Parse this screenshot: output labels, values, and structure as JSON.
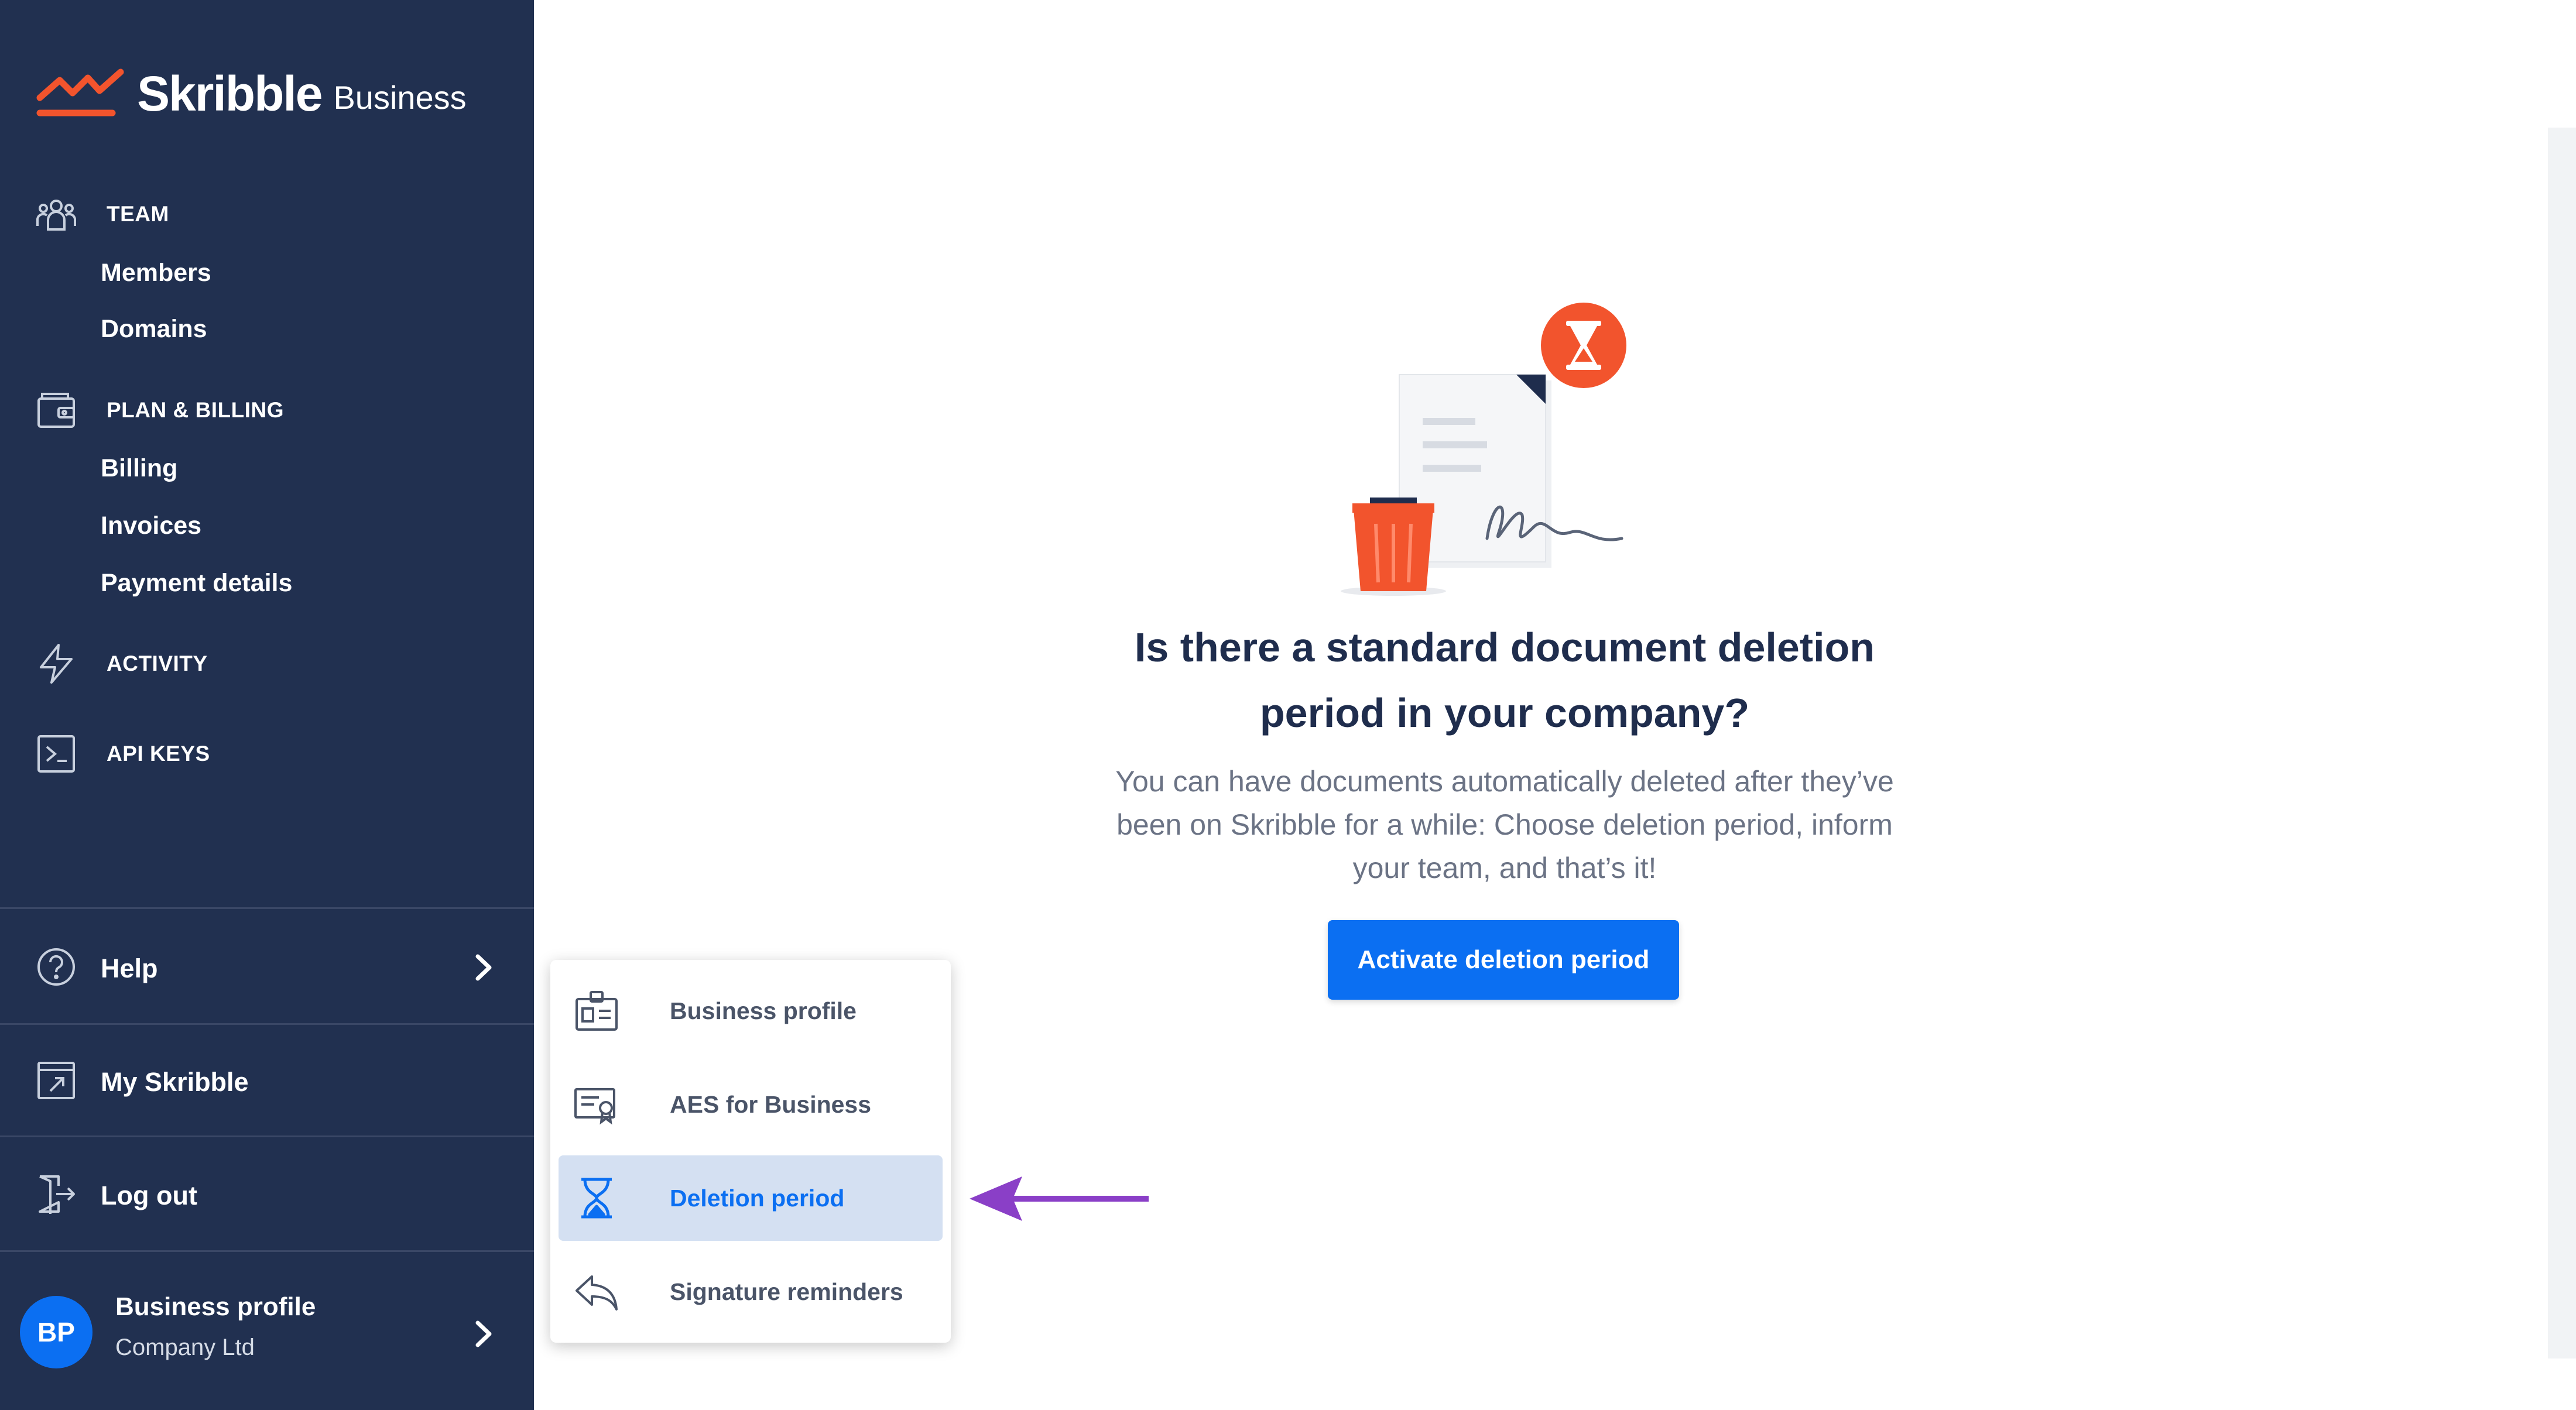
{
  "brand": {
    "name": "Skribble",
    "tier": "Business"
  },
  "sidebar": {
    "team": {
      "label": "TEAM",
      "items": [
        "Members",
        "Domains"
      ]
    },
    "billing": {
      "label": "PLAN & BILLING",
      "items": [
        "Billing",
        "Invoices",
        "Payment details"
      ]
    },
    "activity": {
      "label": "ACTIVITY"
    },
    "api_keys": {
      "label": "API KEYS"
    },
    "help": {
      "label": "Help"
    },
    "my_skribble": {
      "label": "My Skribble"
    },
    "logout": {
      "label": "Log out"
    },
    "profile": {
      "initials": "BP",
      "name": "Business profile",
      "company": "Company Ltd"
    }
  },
  "main": {
    "headline": "Is there a standard document deletion period in your company?",
    "description": "You can have documents automatically deleted after they’ve been on Skribble for a while: Choose deletion period, inform your team, and that’s it!",
    "cta": "Activate deletion period"
  },
  "popup_menu": {
    "items": [
      {
        "label": "Business profile",
        "icon": "id-card-icon",
        "active": false
      },
      {
        "label": "AES for Business",
        "icon": "certificate-icon",
        "active": false
      },
      {
        "label": "Deletion period",
        "icon": "hourglass-icon",
        "active": true
      },
      {
        "label": "Signature reminders",
        "icon": "reply-icon",
        "active": false
      }
    ]
  },
  "colors": {
    "sidebar_bg": "#213050",
    "accent": "#0b6ff2",
    "brand_orange": "#f2542d",
    "active_item_bg": "#d4e0f2",
    "annotation_arrow": "#8a3fc7"
  }
}
